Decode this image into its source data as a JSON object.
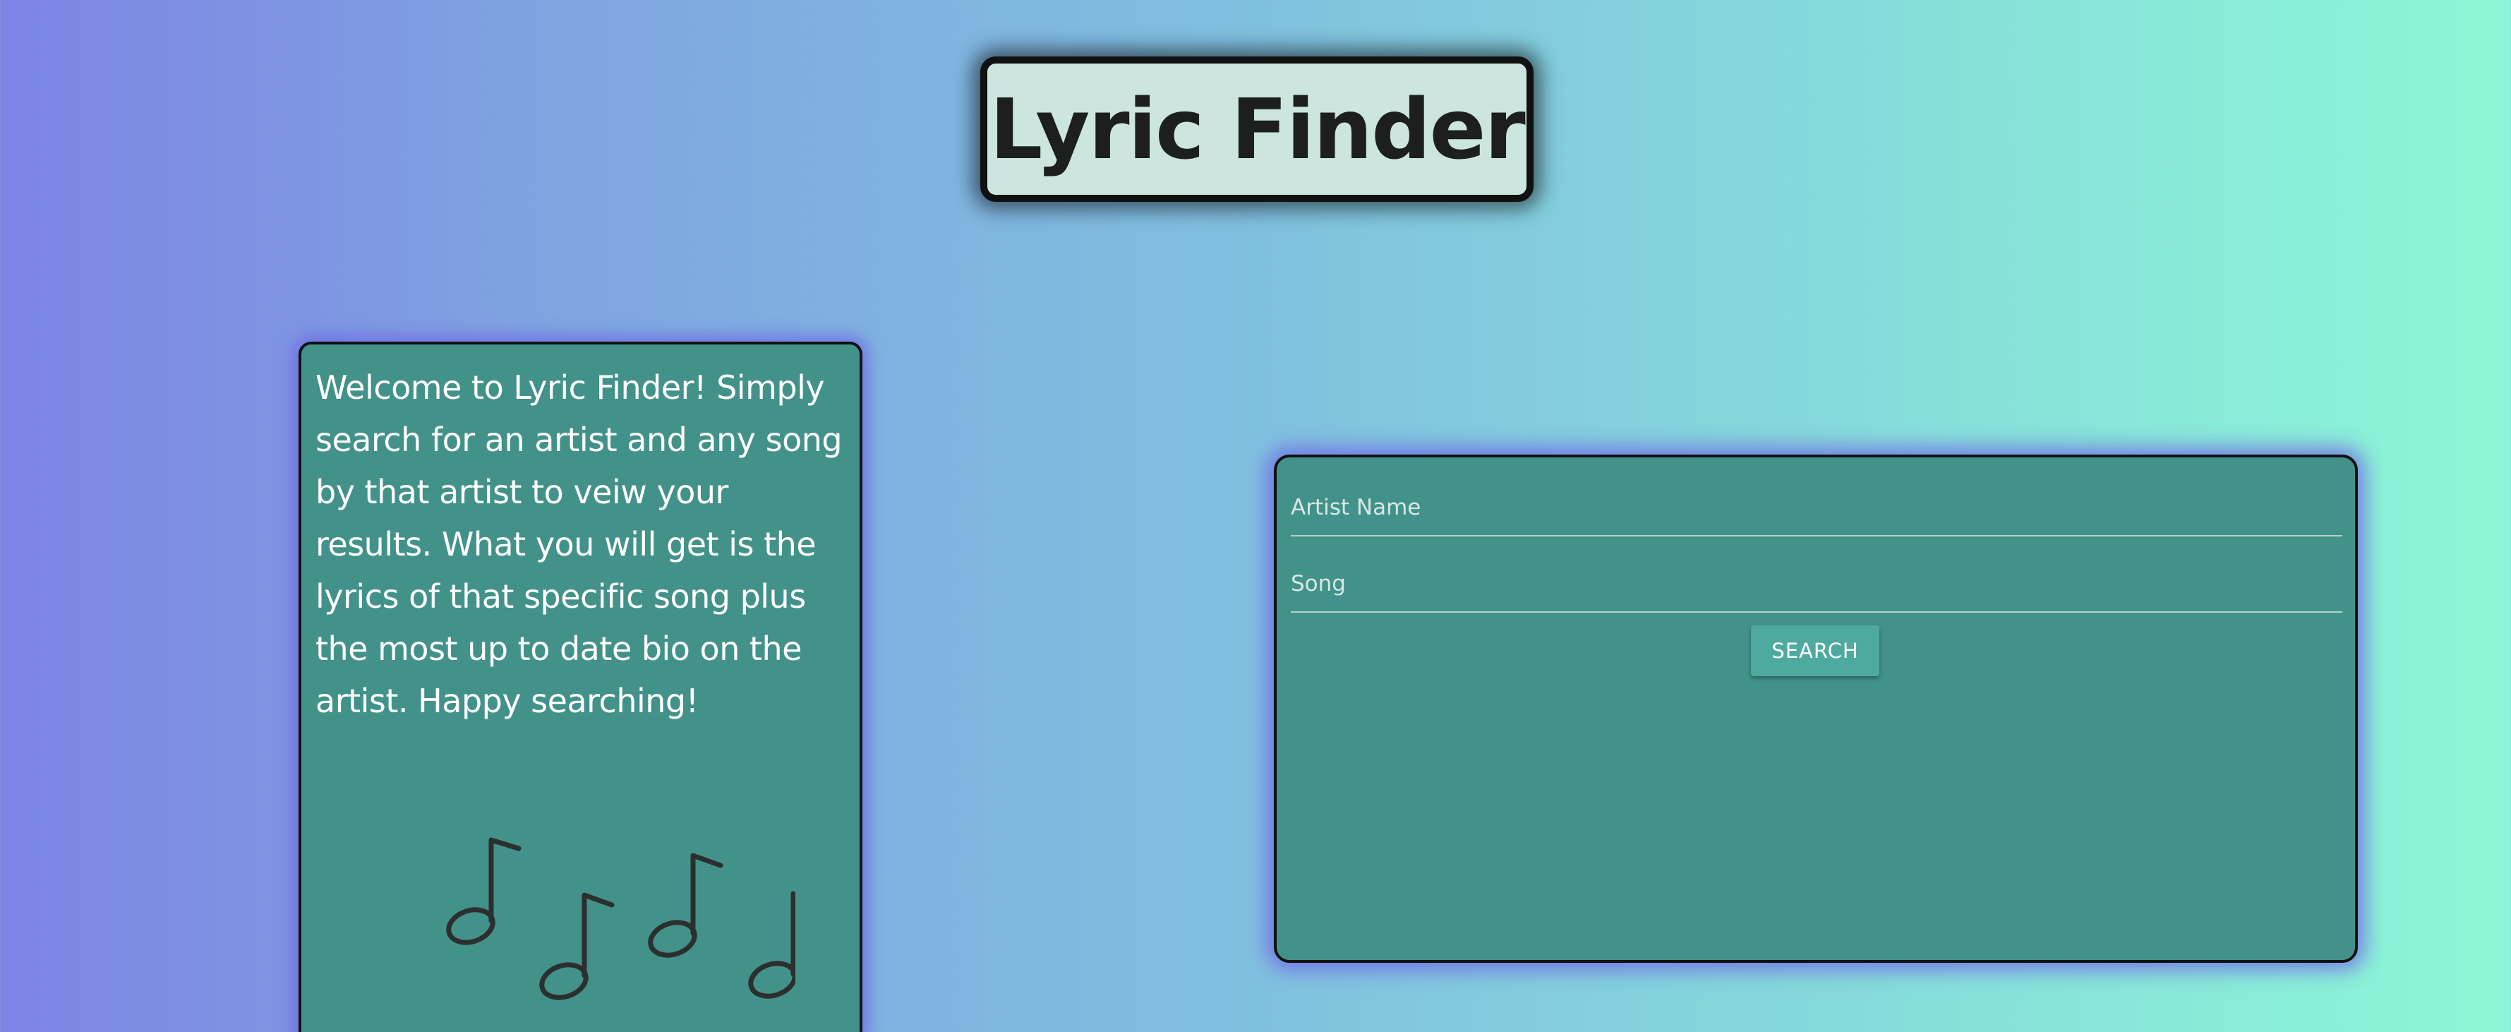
{
  "header": {
    "title": "Lyric Finder"
  },
  "welcome": {
    "text": "Welcome to Lyric Finder! Simply search for an artist and any song by that artist to veiw your results. What you will get is the lyrics of that specific song plus the most up to date bio on the artist. Happy searching!",
    "icon": "music-notes-icon"
  },
  "search": {
    "artist_placeholder": "Artist Name",
    "artist_value": "",
    "song_placeholder": "Song",
    "song_value": "",
    "button_label": "SEARCH"
  },
  "colors": {
    "card_background": "#42928a",
    "title_background": "#cde5df",
    "button_background": "#4eaa9f",
    "gradient_left": "#7d84e4",
    "gradient_right": "#8cf7d6"
  }
}
